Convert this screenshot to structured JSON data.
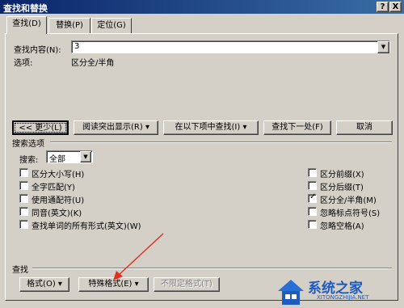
{
  "window": {
    "title": "查找和替换",
    "help_label": "?",
    "close_label": "X"
  },
  "tabs": [
    {
      "label": "查找(D)"
    },
    {
      "label": "替换(P)"
    },
    {
      "label": "定位(G)"
    }
  ],
  "find": {
    "label": "查找内容(N):",
    "value": "3",
    "options_label": "选项:",
    "options_value": "区分全/半角"
  },
  "buttons": {
    "less": "<< 更少(L)",
    "highlight": "阅读突出显示(R) ▾",
    "find_in": "在以下项中查找(I) ▾",
    "find_next": "查找下一处(F)",
    "cancel": "取消"
  },
  "search_options": {
    "section_title": "搜索选项",
    "search_label": "搜索:",
    "search_value": "全部",
    "left": [
      {
        "label": "区分大小写(H)",
        "checked": false
      },
      {
        "label": "全字匹配(Y)",
        "checked": false
      },
      {
        "label": "使用通配符(U)",
        "checked": false
      },
      {
        "label": "同音(英文)(K)",
        "checked": false
      },
      {
        "label": "查找单词的所有形式(英文)(W)",
        "checked": false
      }
    ],
    "right": [
      {
        "label": "区分前缀(X)",
        "checked": false
      },
      {
        "label": "区分后缀(T)",
        "checked": false
      },
      {
        "label": "区分全/半角(M)",
        "checked": true
      },
      {
        "label": "忽略标点符号(S)",
        "checked": false
      },
      {
        "label": "忽略空格(A)",
        "checked": false
      }
    ]
  },
  "bottom": {
    "section_title": "查找",
    "format": "格式(O) ▾",
    "special": "特殊格式(E) ▾",
    "no_format": "不限定格式(T)"
  },
  "watermark": {
    "brand": "系统之家",
    "url": "XITONGZHIJIA.NET"
  },
  "colors": {
    "title_start": "#0a246a",
    "title_end": "#3a6ea5",
    "dialog_bg": "#d4d0c8",
    "arrow": "#e03020"
  }
}
